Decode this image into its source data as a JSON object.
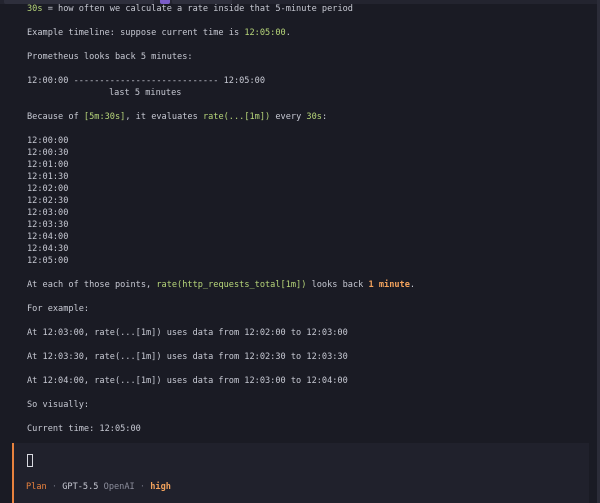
{
  "output": {
    "l1_a": "30s",
    "l1_b": " = how often we calculate a rate inside that 5-minute period",
    "l2_a": "Example timeline: suppose current time is ",
    "l2_b": "12:05:00",
    "l2_c": ".",
    "l3": "Prometheus looks back 5 minutes:",
    "l4": "12:00:00 ---------------------------- 12:05:00",
    "l5": "last 5 minutes",
    "l6_a": "Because of ",
    "l6_b": "[5m:30s]",
    "l6_c": ", it evaluates ",
    "l6_d": "rate(...[1m])",
    "l6_e": " every ",
    "l6_f": "30s",
    "l6_g": ":",
    "times": [
      "12:00:00",
      "12:00:30",
      "12:01:00",
      "12:01:30",
      "12:02:00",
      "12:02:30",
      "12:03:00",
      "12:03:30",
      "12:04:00",
      "12:04:30",
      "12:05:00"
    ],
    "l7_a": "At each of those points, ",
    "l7_b": "rate(http_requests_total[1m])",
    "l7_c": " looks back ",
    "l7_d": "1 minute",
    "l7_e": ".",
    "l8": "For example:",
    "ex1": "At 12:03:00, rate(...[1m]) uses data from 12:02:00 to 12:03:00",
    "ex2": "At 12:03:30, rate(...[1m]) uses data from 12:02:30 to 12:03:30",
    "ex3": "At 12:04:00, rate(...[1m]) uses data from 12:03:00 to 12:04:00",
    "l9": "So visually:",
    "l10": "Current time: 12:05:00"
  },
  "status": {
    "mode": "Plan",
    "sep": " · ",
    "model": "GPT-5.5",
    "provider": "OpenAI",
    "effort": "high"
  },
  "colors": {
    "accent": "#e8823e",
    "highlight_green": "#b7d67a",
    "highlight_orange": "#f2a25c",
    "background": "#1a1b24"
  }
}
